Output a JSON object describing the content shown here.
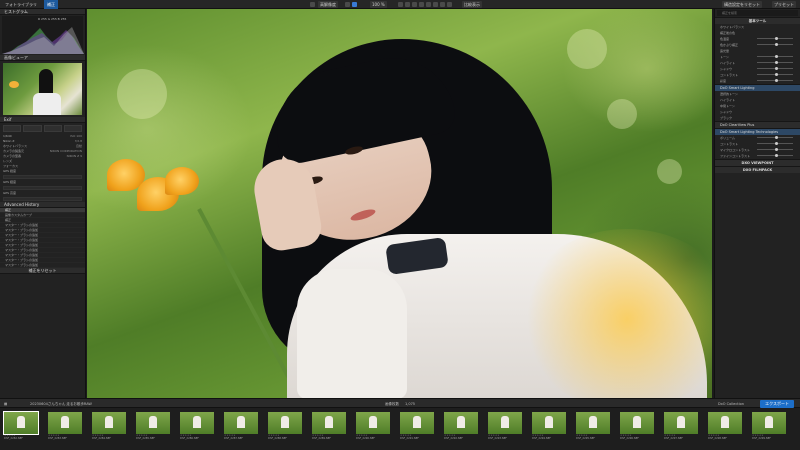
{
  "topbar": {
    "tabs": [
      "フォトライブラリ",
      "補正"
    ],
    "center_label": "高解像度",
    "zoom": "100 %",
    "compare_label": "比較表示",
    "right_buttons": [
      "構造設定をリセット",
      "プリセット"
    ]
  },
  "left_panel": {
    "histogram_title": "ヒストグラム",
    "histogram_readout": "R 255 G 255 B 255",
    "navigator_title": "画像ビューア",
    "info_title": "Exif",
    "info_rows": [
      {
        "label": "1/640",
        "value": "ISO 100"
      },
      {
        "label": "Nikon Z",
        "value": "f/2.8"
      },
      {
        "label": "ホワイトバランス",
        "value": "自動"
      },
      {
        "label": "カメラの製造元",
        "value": "NIKON CORPORATION"
      },
      {
        "label": "カメラの型番",
        "value": "NIKON Z 9"
      },
      {
        "label": "レンズ",
        "value": ""
      },
      {
        "label": "フォーカス",
        "value": ""
      }
    ],
    "gps_labels": [
      "GPS 緯度",
      "GPS 経度",
      "GPS 高度"
    ],
    "advanced_title": "Advanced History",
    "advanced_rows": [
      "補正",
      "画像カスタムカーブ",
      "補正",
      "マスター・ブラシの追加",
      "マスター・ブラシの追加",
      "マスター・ブラシの追加",
      "マスター・ブラシの追加",
      "マスター・ブラシの追加",
      "マスター・ブラシの追加",
      "マスター・ブラシの追加",
      "マスター・ブラシの追加",
      "マスター・ブラシの追加"
    ],
    "footer_label": "補正をリセット"
  },
  "right_panel": {
    "search_placeholder": "補正を検索",
    "basic_title": "基本ツール",
    "rows": [
      "ホワイトバランス",
      "補正後の色",
      "色温度",
      "色かぶり補正",
      "露光量",
      "トーン",
      "ハイライト",
      "シャドウ",
      "コントラスト",
      "彩度"
    ],
    "dxo_smart": "DxO Smart Lighting",
    "dxo_smart_rows": [
      "選択的トーン",
      "ハイライト",
      "中間トーン",
      "シャドウ",
      "ブラック"
    ],
    "dxo_clear": "DxO ClearView Plus",
    "dxo_tone": "DxO Smart Lighting Technologies",
    "dxo_rows": [
      "ボリューム",
      "コントラスト",
      "マイクロコントラスト",
      "ファインコントラスト"
    ],
    "viewpoint": "DXO VIEWPOINT",
    "filmpack": "DXO FILMPACK"
  },
  "stripbar": {
    "folder": "20230604さんちゃん 走るお散歩RAW",
    "count_label": "画像枚数",
    "count_value": "1,075",
    "collection": "DxO Collection",
    "export": "エクスポート"
  },
  "filmstrip": [
    {
      "name": "DSF_2282.NEF"
    },
    {
      "name": "DSF_2283.NEF"
    },
    {
      "name": "DSF_2284.NEF"
    },
    {
      "name": "DSF_2285.NEF"
    },
    {
      "name": "DSF_2286.NEF"
    },
    {
      "name": "DSF_2287.NEF"
    },
    {
      "name": "DSF_2288.NEF"
    },
    {
      "name": "DSF_2289.NEF"
    },
    {
      "name": "DSF_2290.NEF"
    },
    {
      "name": "DSF_2291.NEF"
    },
    {
      "name": "DSF_2292.NEF"
    },
    {
      "name": "DSF_2293.NEF"
    },
    {
      "name": "DSF_2294.NEF"
    },
    {
      "name": "DSF_2295.NEF"
    },
    {
      "name": "DSF_2296.NEF"
    },
    {
      "name": "DSF_2297.NEF"
    },
    {
      "name": "DSF_2298.NEF"
    },
    {
      "name": "DSF_2299.NEF"
    }
  ],
  "colors": {
    "accent": "#1d6fc9",
    "panel": "#222222"
  }
}
